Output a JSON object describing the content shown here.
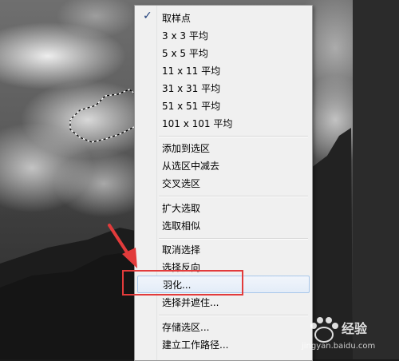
{
  "menu": {
    "items": [
      {
        "label": "取样点",
        "checked": true
      },
      {
        "label": "3 x 3 平均"
      },
      {
        "label": "5 x 5 平均"
      },
      {
        "label": "11 x 11 平均"
      },
      {
        "label": "31 x 31 平均"
      },
      {
        "label": "51 x 51 平均"
      },
      {
        "label": "101 x 101 平均"
      },
      {
        "label": "添加到选区"
      },
      {
        "label": "从选区中减去"
      },
      {
        "label": "交叉选区"
      },
      {
        "label": "扩大选取"
      },
      {
        "label": "选取相似"
      },
      {
        "label": "取消选择"
      },
      {
        "label": "选择反向"
      },
      {
        "label": "羽化...",
        "highlighted": true
      },
      {
        "label": "选择并遮住..."
      },
      {
        "label": "存储选区..."
      },
      {
        "label": "建立工作路径..."
      }
    ],
    "check_glyph": "✓"
  },
  "watermark": {
    "text": "经验",
    "url": "jingyan.baidu.com"
  },
  "colors": {
    "annotation_red": "#e23b3b",
    "highlight_border": "#a8c7ea"
  },
  "icons": [
    "checkmark-icon",
    "annotation-arrow-icon",
    "paw-logo-icon"
  ]
}
